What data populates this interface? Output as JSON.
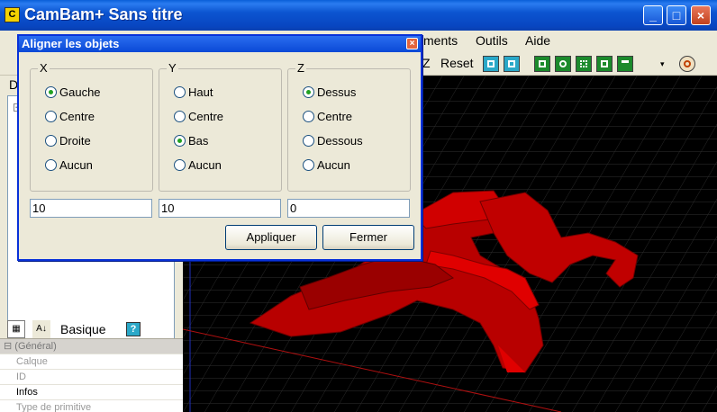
{
  "app": {
    "logo_text": "C",
    "title": "CamBam+  Sans titre",
    "minimize_label": "_",
    "maximize_label": "□",
    "close_label": "×"
  },
  "menubar": {
    "items": [
      "ments",
      "Outils",
      "Aide"
    ]
  },
  "toolbar": {
    "z_label": "Z",
    "reset_label": "Reset",
    "icons": [
      "zoom-in-icon",
      "zoom-icon",
      "pocket-icon",
      "circle-icon",
      "drill-icon",
      "profile-icon",
      "text-icon",
      "target-icon"
    ]
  },
  "left_panel": {
    "top_label": "D",
    "expand_glyph": "−",
    "prop_toolbar": {
      "basique_label": "Basique",
      "help_glyph": "?",
      "sort_glyph": "A↓"
    },
    "properties": [
      {
        "label": "(Général)",
        "kind": "category",
        "glyph": "⊟"
      },
      {
        "label": "Calque",
        "kind": "row"
      },
      {
        "label": "ID",
        "kind": "row"
      },
      {
        "label": "Infos",
        "kind": "row-dark"
      },
      {
        "label": "Type de primitive",
        "kind": "row"
      }
    ]
  },
  "dialog": {
    "title": "Aligner les objets",
    "close_glyph": "×",
    "groups": [
      {
        "label": "X",
        "options": [
          {
            "label": "Gauche",
            "checked": true
          },
          {
            "label": "Centre",
            "checked": false
          },
          {
            "label": "Droite",
            "checked": false
          },
          {
            "label": "Aucun",
            "checked": false
          }
        ],
        "value": "10"
      },
      {
        "label": "Y",
        "options": [
          {
            "label": "Haut",
            "checked": false
          },
          {
            "label": "Centre",
            "checked": false
          },
          {
            "label": "Bas",
            "checked": true
          },
          {
            "label": "Aucun",
            "checked": false
          }
        ],
        "value": "10"
      },
      {
        "label": "Z",
        "options": [
          {
            "label": "Dessus",
            "checked": true
          },
          {
            "label": "Centre",
            "checked": false
          },
          {
            "label": "Dessous",
            "checked": false
          },
          {
            "label": "Aucun",
            "checked": false
          }
        ],
        "value": "0"
      }
    ],
    "apply_label": "Appliquer",
    "close_label": "Fermer"
  },
  "colors": {
    "viewport_bg": "#000000",
    "model_red": "#c00000",
    "grid": "#2c2c2c"
  }
}
